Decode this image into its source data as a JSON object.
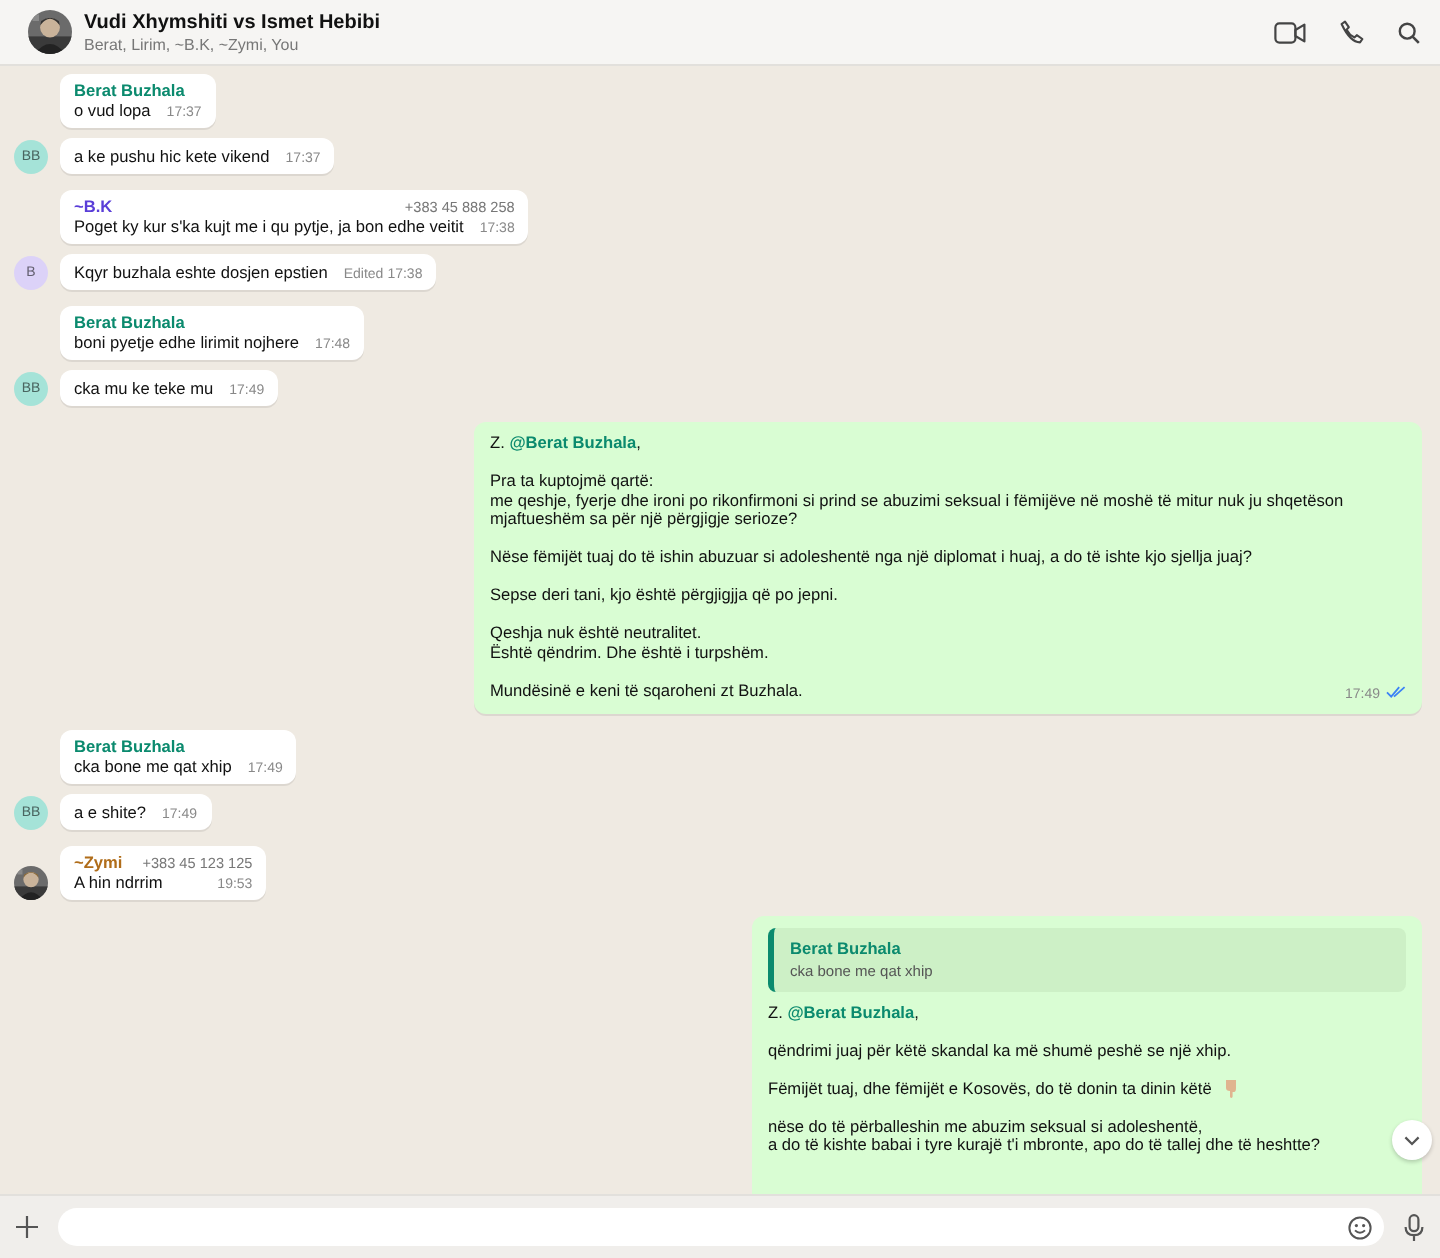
{
  "header": {
    "title": "Vudi Xhymshiti vs Ismet Hebibi",
    "subtitle": "Berat, Lirim, ~B.K, ~Zymi, You"
  },
  "messages": [
    {
      "kind": "in",
      "sender": "Berat Buzhala",
      "color": "#0b8a6e",
      "text": "o vud lopa",
      "time": "17:37"
    },
    {
      "kind": "in",
      "text": "a ke pushu hic kete vikend",
      "time": "17:37",
      "avatar": {
        "kind": "initials",
        "initials": "BB",
        "color": "#a5e3d8"
      }
    },
    {
      "kind": "in",
      "sender": "~B.K",
      "color": "#5a3ed8",
      "phone": "+383 45 888 258",
      "text": "Poget ky kur s'ka kujt me i qu pytje, ja bon edhe veitit",
      "time": "17:38"
    },
    {
      "kind": "in",
      "text": "Kqyr buzhala eshte dosjen epstien",
      "edited_label": "Edited",
      "time": "17:38",
      "avatar": {
        "kind": "initials",
        "initials": "B",
        "color": "#dcd2f8"
      }
    },
    {
      "kind": "in",
      "sender": "Berat Buzhala",
      "color": "#0b8a6e",
      "text": "boni pyetje edhe lirimit nojhere",
      "time": "17:48"
    },
    {
      "kind": "in",
      "text": "cka mu ke teke mu",
      "time": "17:49",
      "avatar": {
        "kind": "initials",
        "initials": "BB",
        "color": "#a5e3d8"
      }
    },
    {
      "kind": "out",
      "paragraphs": [
        {
          "text": "Z. **@Berat Buzhala**,"
        },
        {
          "text": "Pra ta kuptojmë qartë:\nme qeshje, fyerje dhe ironi po rikonfirmoni si prind se abuzimi seksual i fëmijëve në moshë të mitur nuk ju shqetëson mjaftueshëm sa për një përgjigje serioze?"
        },
        {
          "text": "Nëse fëmijët tuaj do të ishin abuzuar si adoleshentë nga një diplomat i huaj, a do të ishte kjo sjellja juaj?"
        },
        {
          "text": "Sepse deri tani, kjo është përgjigjja që po jepni."
        },
        {
          "text": "Qeshja nuk është neutralitet.\nËshtë qëndrim. Dhe është i turpshëm."
        },
        {
          "text": "Mundësinë e keni të sqaroheni zt Buzhala."
        }
      ],
      "time": "17:49",
      "read": true
    },
    {
      "kind": "in",
      "sender": "Berat Buzhala",
      "color": "#0b8a6e",
      "text": "cka bone me qat xhip",
      "time": "17:49"
    },
    {
      "kind": "in",
      "text": "a e shite?",
      "time": "17:49",
      "avatar": {
        "kind": "initials",
        "initials": "BB",
        "color": "#a5e3d8"
      }
    },
    {
      "kind": "in",
      "sender": "~Zymi",
      "color": "#b06d1a",
      "phone": "+383 45 123 125",
      "text": "A hin ndrrim",
      "time": "19:53"
    },
    {
      "kind": "out",
      "quote": {
        "sender": "Berat Buzhala",
        "text": "cka bone me qat xhip"
      },
      "paragraphs": [
        {
          "text": "Z. **@Berat Buzhala**,"
        },
        {
          "text": "qëndrimi juaj për këtë skandal ka më shumë peshë se një xhip."
        },
        {
          "text": "Fëmijët tuaj, dhe fëmijët e Kosovës, do të donin ta dinin këtë",
          "pointing_hand": true
        },
        {
          "text": "nëse do të përballeshin me abuzim seksual si adoleshentë,\na do të kishte babai i tyre kurajë t'i mbronte, apo do të tallej dhe të heshtte?"
        }
      ]
    }
  ]
}
